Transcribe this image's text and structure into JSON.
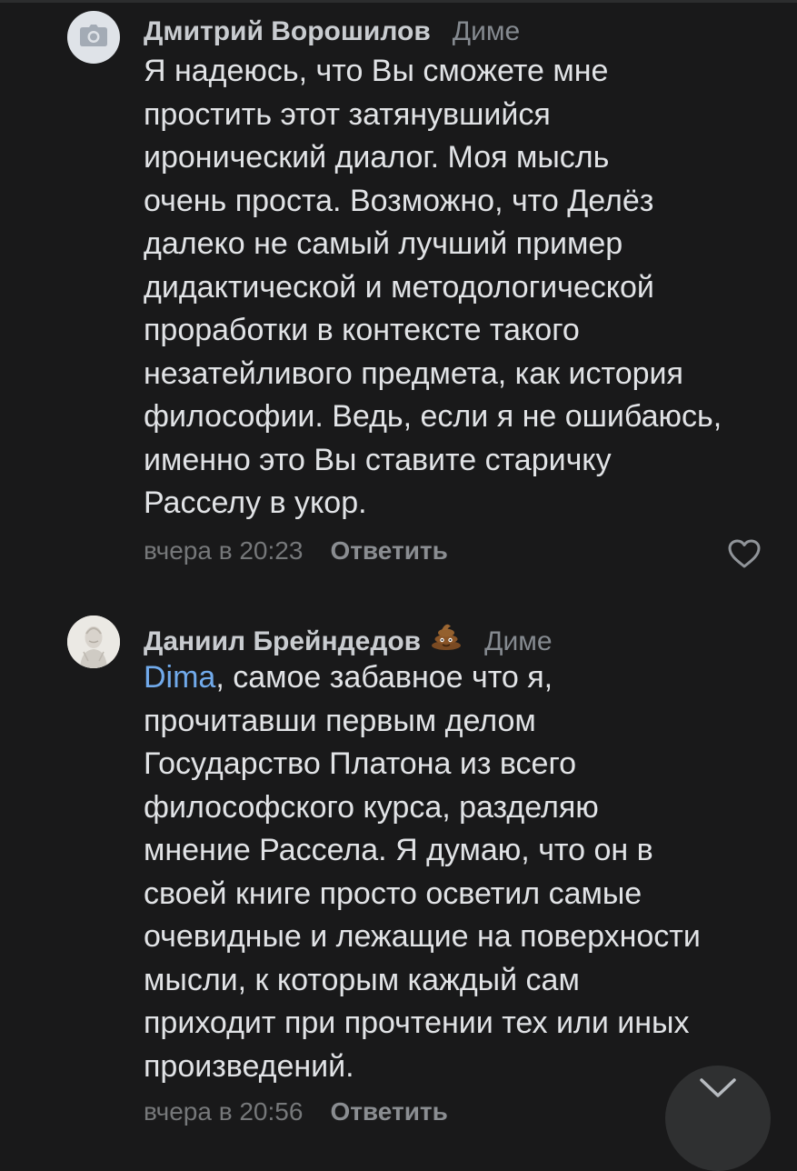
{
  "comments": [
    {
      "author": "Дмитрий Ворошилов",
      "reply_to": "Диме",
      "avatar_icon": "camera-icon",
      "text": "Я надеюсь, что Вы сможете мне\nпростить этот затянувшийся\nиронический диалог. Моя мысль\nочень проста. Возможно, что Делёз\nдалеко не самый лучший пример\nдидактической и методологической\nпроработки в контексте такого\nнезатейливого предмета, как история\nфилософии. Ведь, если я не ошибаюсь,\nименно это Вы ставите старичку\nРасселу в укор.",
      "time": "вчера в 20:23",
      "reply_label": "Ответить",
      "like_icon": "heart-icon"
    },
    {
      "author": "Даниил Брейндедов",
      "author_emoji": "pile-of-poo-emoji",
      "reply_to": "Диме",
      "mention": "Dima",
      "text": ", самое забавное что я,\nпрочитавши первым делом\nГосударство Платона из всего\nфилософского курса, разделяю\nмнение Рассела. Я думаю, что он в\nсвоей книге просто осветил самые\nочевидные и лежащие на поверхности\nмысли, к которым каждый сам\nприходит при прочтении тех или иных\nпроизведений.",
      "time": "вчера в 20:56",
      "reply_label": "Ответить"
    }
  ],
  "scroll_down_icon": "chevron-down-icon",
  "colors": {
    "background": "#19191a",
    "text": "#e1e3e6",
    "author": "#c9ccd0",
    "secondary": "#858a90",
    "mention": "#71aaeb",
    "fab": "#2f3031"
  }
}
